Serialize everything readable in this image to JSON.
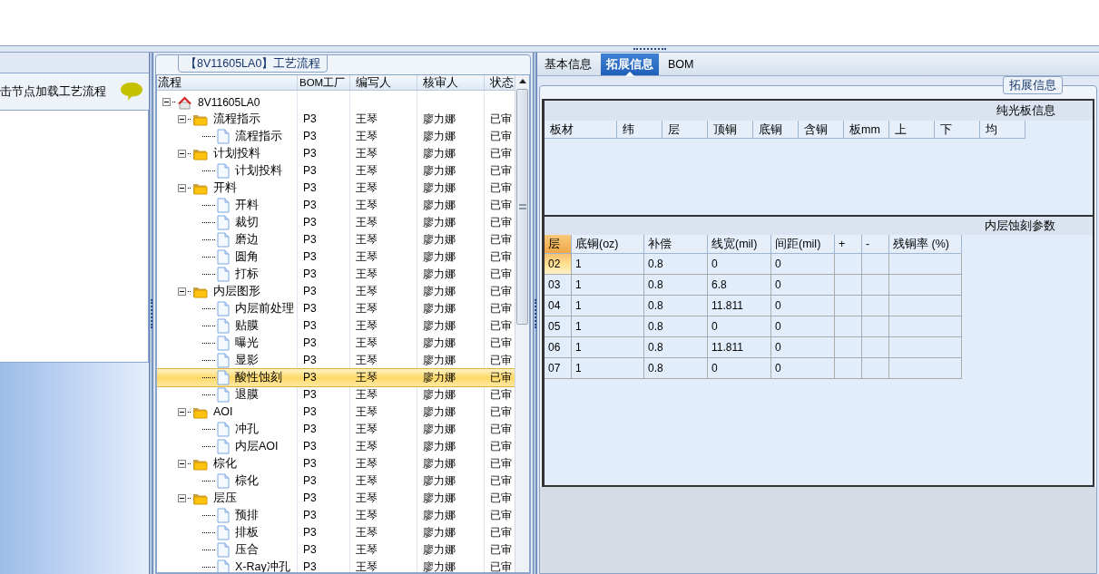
{
  "left_panel": {
    "hint": "击节点加载工艺流程"
  },
  "process_panel": {
    "title": "【8V11605LA0】工艺流程",
    "columns": [
      "流程",
      "BOM工厂",
      "编写人",
      "核审人",
      "状态"
    ],
    "tree": [
      {
        "kind": "root",
        "label": "8V11605LA0",
        "expanded": true,
        "selected": false,
        "children": [
          {
            "kind": "folder",
            "label": "流程指示",
            "expanded": true,
            "selected": false,
            "cells": [
              "P3",
              "王琴",
              "廖力娜",
              "已审"
            ],
            "children": [
              {
                "kind": "file",
                "label": "流程指示",
                "selected": false,
                "cells": [
                  "P3",
                  "王琴",
                  "廖力娜",
                  "已审"
                ]
              }
            ]
          },
          {
            "kind": "folder",
            "label": "计划投料",
            "expanded": true,
            "selected": false,
            "cells": [
              "P3",
              "王琴",
              "廖力娜",
              "已审"
            ],
            "children": [
              {
                "kind": "file",
                "label": "计划投料",
                "selected": false,
                "cells": [
                  "P3",
                  "王琴",
                  "廖力娜",
                  "已审"
                ]
              }
            ]
          },
          {
            "kind": "folder",
            "label": "开料",
            "expanded": true,
            "selected": false,
            "cells": [
              "P3",
              "王琴",
              "廖力娜",
              "已审"
            ],
            "children": [
              {
                "kind": "file",
                "label": "开料",
                "selected": false,
                "cells": [
                  "P3",
                  "王琴",
                  "廖力娜",
                  "已审"
                ]
              },
              {
                "kind": "file",
                "label": "裁切",
                "selected": false,
                "cells": [
                  "P3",
                  "王琴",
                  "廖力娜",
                  "已审"
                ]
              },
              {
                "kind": "file",
                "label": "磨边",
                "selected": false,
                "cells": [
                  "P3",
                  "王琴",
                  "廖力娜",
                  "已审"
                ]
              },
              {
                "kind": "file",
                "label": "圆角",
                "selected": false,
                "cells": [
                  "P3",
                  "王琴",
                  "廖力娜",
                  "已审"
                ]
              },
              {
                "kind": "file",
                "label": "打标",
                "selected": false,
                "cells": [
                  "P3",
                  "王琴",
                  "廖力娜",
                  "已审"
                ]
              }
            ]
          },
          {
            "kind": "folder",
            "label": "内层图形",
            "expanded": true,
            "selected": false,
            "cells": [
              "P3",
              "王琴",
              "廖力娜",
              "已审"
            ],
            "children": [
              {
                "kind": "file",
                "label": "内层前处理",
                "selected": false,
                "cells": [
                  "P3",
                  "王琴",
                  "廖力娜",
                  "已审"
                ]
              },
              {
                "kind": "file",
                "label": "贴膜",
                "selected": false,
                "cells": [
                  "P3",
                  "王琴",
                  "廖力娜",
                  "已审"
                ]
              },
              {
                "kind": "file",
                "label": "曝光",
                "selected": false,
                "cells": [
                  "P3",
                  "王琴",
                  "廖力娜",
                  "已审"
                ]
              },
              {
                "kind": "file",
                "label": "显影",
                "selected": false,
                "cells": [
                  "P3",
                  "王琴",
                  "廖力娜",
                  "已审"
                ]
              },
              {
                "kind": "file",
                "label": "酸性蚀刻",
                "selected": true,
                "cells": [
                  "P3",
                  "王琴",
                  "廖力娜",
                  "已审"
                ]
              },
              {
                "kind": "file",
                "label": "退膜",
                "selected": false,
                "cells": [
                  "P3",
                  "王琴",
                  "廖力娜",
                  "已审"
                ]
              }
            ]
          },
          {
            "kind": "folder",
            "label": "AOI",
            "expanded": true,
            "selected": false,
            "cells": [
              "P3",
              "王琴",
              "廖力娜",
              "已审"
            ],
            "children": [
              {
                "kind": "file",
                "label": "冲孔",
                "selected": false,
                "cells": [
                  "P3",
                  "王琴",
                  "廖力娜",
                  "已审"
                ]
              },
              {
                "kind": "file",
                "label": "内层AOI",
                "selected": false,
                "cells": [
                  "P3",
                  "王琴",
                  "廖力娜",
                  "已审"
                ]
              }
            ]
          },
          {
            "kind": "folder",
            "label": "棕化",
            "expanded": true,
            "selected": false,
            "cells": [
              "P3",
              "王琴",
              "廖力娜",
              "已审"
            ],
            "children": [
              {
                "kind": "file",
                "label": "棕化",
                "selected": false,
                "cells": [
                  "P3",
                  "王琴",
                  "廖力娜",
                  "已审"
                ]
              }
            ]
          },
          {
            "kind": "folder",
            "label": "层压",
            "expanded": true,
            "selected": false,
            "cells": [
              "P3",
              "王琴",
              "廖力娜",
              "已审"
            ],
            "children": [
              {
                "kind": "file",
                "label": "预排",
                "selected": false,
                "cells": [
                  "P3",
                  "王琴",
                  "廖力娜",
                  "已审"
                ]
              },
              {
                "kind": "file",
                "label": "排板",
                "selected": false,
                "cells": [
                  "P3",
                  "王琴",
                  "廖力娜",
                  "已审"
                ]
              },
              {
                "kind": "file",
                "label": "压合",
                "selected": false,
                "cells": [
                  "P3",
                  "王琴",
                  "廖力娜",
                  "已审"
                ]
              },
              {
                "kind": "file",
                "label": "X-Ray冲孔",
                "selected": false,
                "cells": [
                  "P3",
                  "王琴",
                  "廖力娜",
                  "已审"
                ]
              }
            ]
          }
        ]
      }
    ]
  },
  "detail_panel": {
    "tabs": [
      {
        "label": "基本信息",
        "selected": false
      },
      {
        "label": "拓展信息",
        "selected": true
      },
      {
        "label": "BOM",
        "selected": false
      }
    ],
    "group_title": "拓展信息",
    "bare_board": {
      "title": "纯光板信息",
      "columns": [
        "板材",
        "纬",
        "层",
        "顶铜",
        "底铜",
        "含铜",
        "板mm",
        "上",
        "下",
        "均"
      ]
    },
    "inner_etch": {
      "title": "内层蚀刻参数",
      "columns": [
        "层",
        "底铜(oz)",
        "补偿",
        "线宽(mil)",
        "间距(mil)",
        "+",
        "-",
        "残铜率 (%)"
      ],
      "rows": [
        {
          "selected": true,
          "cells": [
            "02",
            "1",
            "0.8",
            "0",
            "0"
          ]
        },
        {
          "selected": false,
          "cells": [
            "03",
            "1",
            "0.8",
            "6.8",
            "0"
          ]
        },
        {
          "selected": false,
          "cells": [
            "04",
            "1",
            "0.8",
            "11.811",
            "0"
          ]
        },
        {
          "selected": false,
          "cells": [
            "05",
            "1",
            "0.8",
            "0",
            "0"
          ]
        },
        {
          "selected": false,
          "cells": [
            "06",
            "1",
            "0.8",
            "11.811",
            "0"
          ]
        },
        {
          "selected": false,
          "cells": [
            "07",
            "1",
            "0.8",
            "0",
            "0"
          ]
        }
      ]
    }
  }
}
